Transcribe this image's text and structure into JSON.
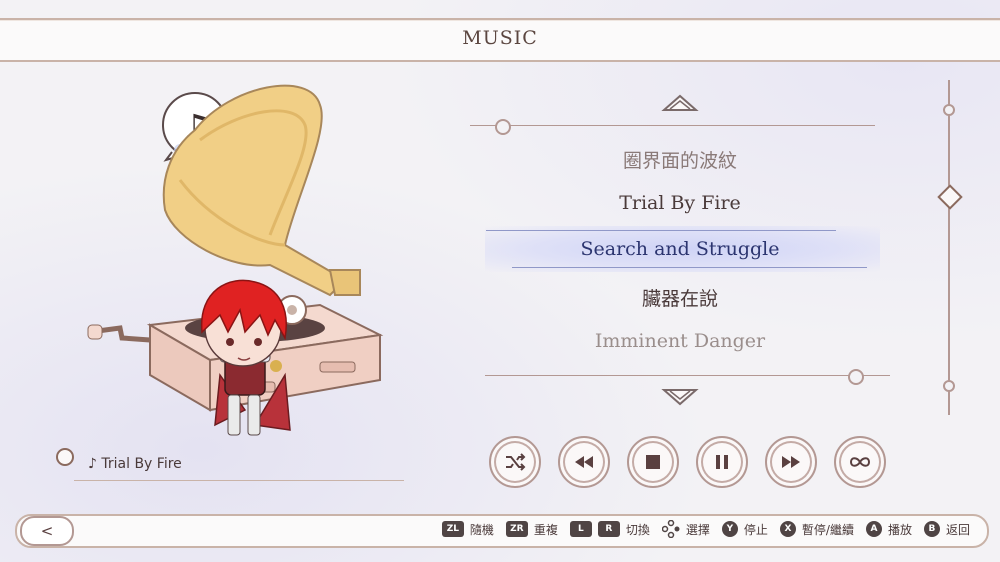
{
  "header": {
    "title": "MUSIC"
  },
  "music_list": {
    "items": [
      {
        "title": "圈界面的波紋"
      },
      {
        "title": "Trial By Fire"
      },
      {
        "title": "Search and Struggle"
      },
      {
        "title": "臟器在說"
      },
      {
        "title": "Imminent Danger"
      }
    ],
    "selected_index": 2,
    "scroll_position": 0.37
  },
  "now_playing": {
    "prefix": "♪",
    "title": "Trial By Fire"
  },
  "controls": [
    {
      "name": "shuffle",
      "icon": "shuffle-icon"
    },
    {
      "name": "rewind",
      "icon": "rewind-icon"
    },
    {
      "name": "stop",
      "icon": "stop-icon"
    },
    {
      "name": "pause",
      "icon": "pause-icon"
    },
    {
      "name": "fast-forward",
      "icon": "fast-forward-icon"
    },
    {
      "name": "loop",
      "icon": "infinity-icon"
    }
  ],
  "back_button": {
    "label": "<"
  },
  "hints": [
    {
      "key": "ZL",
      "label": "隨機"
    },
    {
      "key": "ZR",
      "label": "重複"
    },
    {
      "key": "L",
      "key2": "R",
      "label": "切換"
    },
    {
      "key": "dpad",
      "label": "選擇"
    },
    {
      "key": "Y",
      "label": "停止"
    },
    {
      "key": "X",
      "label": "暫停/繼續"
    },
    {
      "key": "A",
      "label": "播放"
    },
    {
      "key": "B",
      "label": "返回"
    }
  ],
  "colors": {
    "accent": "#b39893",
    "selected_text": "#2c3570",
    "selection_glow": "#cdd2f6",
    "hair_red": "#e02222",
    "horn_gold": "#f1cf86"
  }
}
